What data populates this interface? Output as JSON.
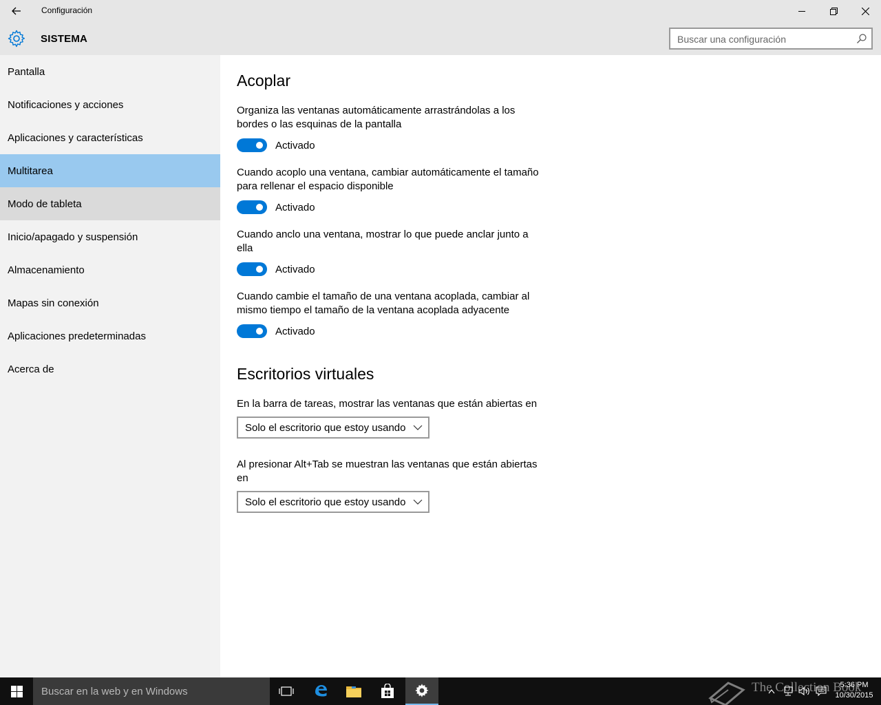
{
  "window": {
    "title": "Configuración"
  },
  "header": {
    "section_title": "SISTEMA",
    "search_placeholder": "Buscar una configuración"
  },
  "sidebar": {
    "items": [
      {
        "label": "Pantalla"
      },
      {
        "label": "Notificaciones y acciones"
      },
      {
        "label": "Aplicaciones y características"
      },
      {
        "label": "Multitarea",
        "selected": true
      },
      {
        "label": "Modo de tableta",
        "hover": true
      },
      {
        "label": "Inicio/apagado y suspensión"
      },
      {
        "label": "Almacenamiento"
      },
      {
        "label": "Mapas sin conexión"
      },
      {
        "label": "Aplicaciones predeterminadas"
      },
      {
        "label": "Acerca de"
      }
    ]
  },
  "main": {
    "snap": {
      "heading": "Acoplar",
      "settings": [
        {
          "description": "Organiza las ventanas automáticamente arrastrándolas a los bordes o las esquinas de la pantalla",
          "toggle_label": "Activado",
          "on": true
        },
        {
          "description": "Cuando acoplo una ventana, cambiar automáticamente el tamaño para rellenar el espacio disponible",
          "toggle_label": "Activado",
          "on": true
        },
        {
          "description": "Cuando anclo una ventana, mostrar lo que puede anclar junto a ella",
          "toggle_label": "Activado",
          "on": true
        },
        {
          "description": "Cuando cambie el tamaño de una ventana acoplada, cambiar al mismo tiempo el tamaño de la ventana acoplada adyacente",
          "toggle_label": "Activado",
          "on": true
        }
      ]
    },
    "virtual_desktops": {
      "heading": "Escritorios virtuales",
      "taskbar_setting": {
        "description": "En la barra de tareas, mostrar las ventanas que están abiertas en",
        "selected": "Solo el escritorio que estoy usando"
      },
      "alttab_setting": {
        "description": "Al presionar Alt+Tab se muestran las ventanas que están abiertas en",
        "selected": "Solo el escritorio que estoy usando"
      }
    }
  },
  "taskbar": {
    "search_placeholder": "Buscar en la web y en Windows",
    "watermark": "The Collection Book",
    "time": "5:36 PM",
    "date": "10/30/2015"
  },
  "colors": {
    "accent": "#0078d7",
    "selected_nav": "#99c9ef",
    "chrome": "#e6e6e6",
    "sidebar": "#f2f2f2",
    "taskbar": "#101010"
  }
}
